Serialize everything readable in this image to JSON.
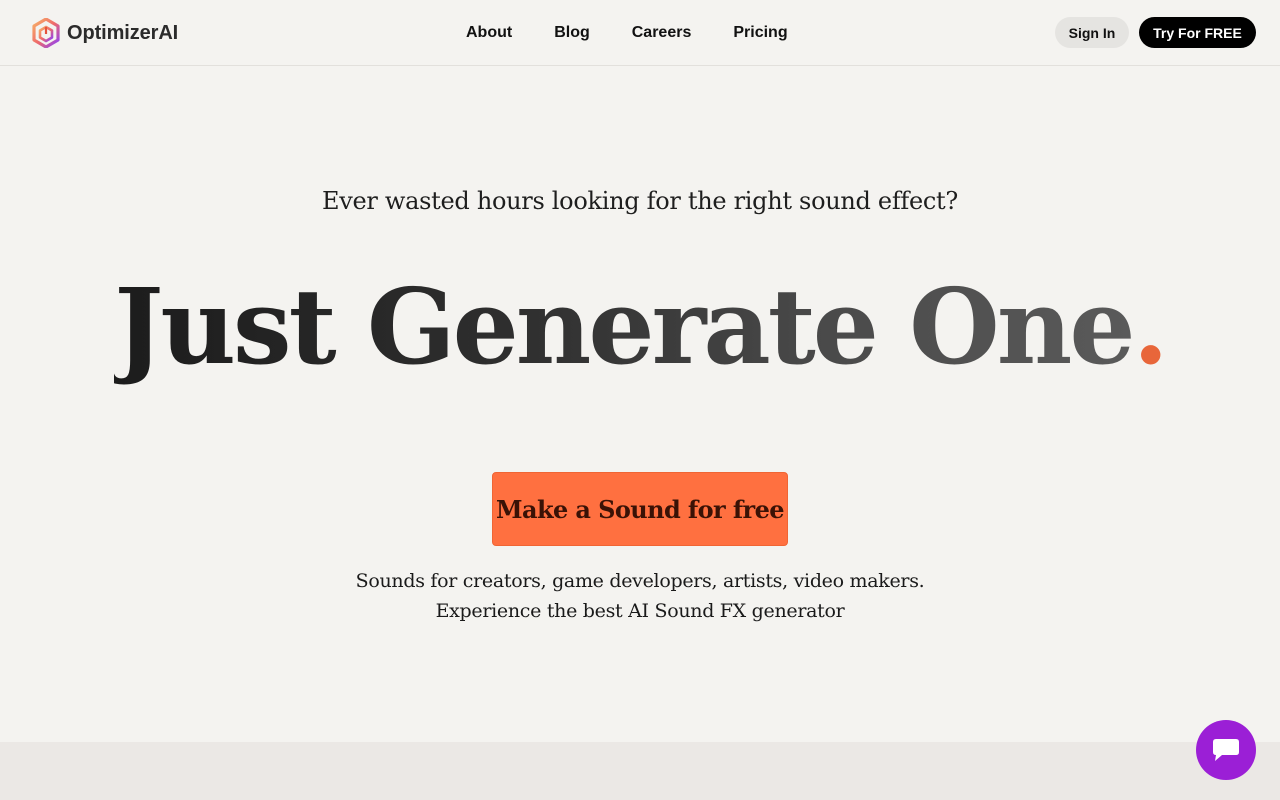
{
  "header": {
    "brand_name": "OptimizerAI",
    "nav": [
      "About",
      "Blog",
      "Careers",
      "Pricing"
    ],
    "signin_label": "Sign In",
    "try_label": "Try For FREE"
  },
  "hero": {
    "tagline": "Ever wasted hours looking for the right sound effect?",
    "headline_words": "Just Generate One",
    "headline_dot": ".",
    "cta_label": "Make a Sound for free",
    "sub_line1": "Sounds for creators, game developers, artists, video makers.",
    "sub_line2": "Experience the best AI Sound FX generator"
  },
  "icons": {
    "logo": "optimizer-logo-icon",
    "chat": "chat-bubble-icon"
  },
  "colors": {
    "background": "#f4f3f0",
    "accent": "#ff7040",
    "accent_dot": "#e8663a",
    "chat": "#9b1fd6",
    "primary_button": "#000000"
  }
}
